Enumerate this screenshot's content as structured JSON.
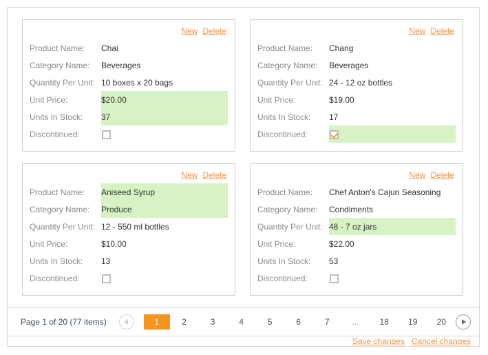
{
  "cards": [
    {
      "actions": {
        "new": "New",
        "delete": "Delete"
      },
      "fields": [
        {
          "label": "Product Name:",
          "value": "Chai",
          "edited": false,
          "type": "text"
        },
        {
          "label": "Category Name:",
          "value": "Beverages",
          "edited": false,
          "type": "text"
        },
        {
          "label": "Quantity Per Unit:",
          "value": "10 boxes x 20 bags",
          "edited": false,
          "type": "text"
        },
        {
          "label": "Unit Price:",
          "value": "$20.00",
          "edited": true,
          "type": "text"
        },
        {
          "label": "Units In Stock:",
          "value": "37",
          "edited": true,
          "type": "text"
        },
        {
          "label": "Discontinued:",
          "value": "",
          "edited": false,
          "type": "checkbox",
          "checked": false
        }
      ]
    },
    {
      "actions": {
        "new": "New",
        "delete": "Delete"
      },
      "fields": [
        {
          "label": "Product Name:",
          "value": "Chang",
          "edited": false,
          "type": "text"
        },
        {
          "label": "Category Name:",
          "value": "Beverages",
          "edited": false,
          "type": "text"
        },
        {
          "label": "Quantity Per Unit:",
          "value": "24 - 12 oz bottles",
          "edited": false,
          "type": "text"
        },
        {
          "label": "Unit Price:",
          "value": "$19.00",
          "edited": false,
          "type": "text"
        },
        {
          "label": "Units In Stock:",
          "value": "17",
          "edited": false,
          "type": "text"
        },
        {
          "label": "Discontinued:",
          "value": "",
          "edited": true,
          "type": "checkbox",
          "checked": true
        }
      ]
    },
    {
      "actions": {
        "new": "New",
        "delete": "Delete"
      },
      "fields": [
        {
          "label": "Product Name:",
          "value": "Aniseed Syrup",
          "edited": true,
          "type": "text"
        },
        {
          "label": "Category Name:",
          "value": "Produce",
          "edited": true,
          "type": "text"
        },
        {
          "label": "Quantity Per Unit:",
          "value": "12 - 550 ml bottles",
          "edited": false,
          "type": "text"
        },
        {
          "label": "Unit Price:",
          "value": "$10.00",
          "edited": false,
          "type": "text"
        },
        {
          "label": "Units In Stock:",
          "value": "13",
          "edited": false,
          "type": "text"
        },
        {
          "label": "Discontinued:",
          "value": "",
          "edited": false,
          "type": "checkbox",
          "checked": false
        }
      ]
    },
    {
      "actions": {
        "new": "New",
        "delete": "Delete"
      },
      "fields": [
        {
          "label": "Product Name:",
          "value": "Chef Anton's Cajun Seasoning",
          "edited": false,
          "type": "text"
        },
        {
          "label": "Category Name:",
          "value": "Condiments",
          "edited": false,
          "type": "text"
        },
        {
          "label": "Quantity Per Unit:",
          "value": "48 - 7 oz jars",
          "edited": true,
          "type": "text"
        },
        {
          "label": "Unit Price:",
          "value": "$22.00",
          "edited": false,
          "type": "text"
        },
        {
          "label": "Units In Stock:",
          "value": "53",
          "edited": false,
          "type": "text"
        },
        {
          "label": "Discontinued:",
          "value": "",
          "edited": false,
          "type": "checkbox",
          "checked": false
        }
      ]
    }
  ],
  "pager": {
    "info": "Page 1 of 20 (77 items)",
    "prev_icon": "chevron-left-icon",
    "next_icon": "chevron-right-icon",
    "current_page": "1",
    "pages": [
      "1",
      "2",
      "3",
      "4",
      "5",
      "6",
      "7",
      "...",
      "18",
      "19",
      "20"
    ]
  },
  "footer": {
    "save_label": "Save changes",
    "cancel_label": "Cancel changes"
  },
  "colors": {
    "accent": "#f7941d",
    "link": "#f79646",
    "edited_cell": "#d7f2c3",
    "label_text": "#8a8a8a",
    "value_text": "#333333",
    "page_text": "#3f4d5e",
    "border": "#d6d6d6",
    "card_border": "#cfcfcf"
  }
}
